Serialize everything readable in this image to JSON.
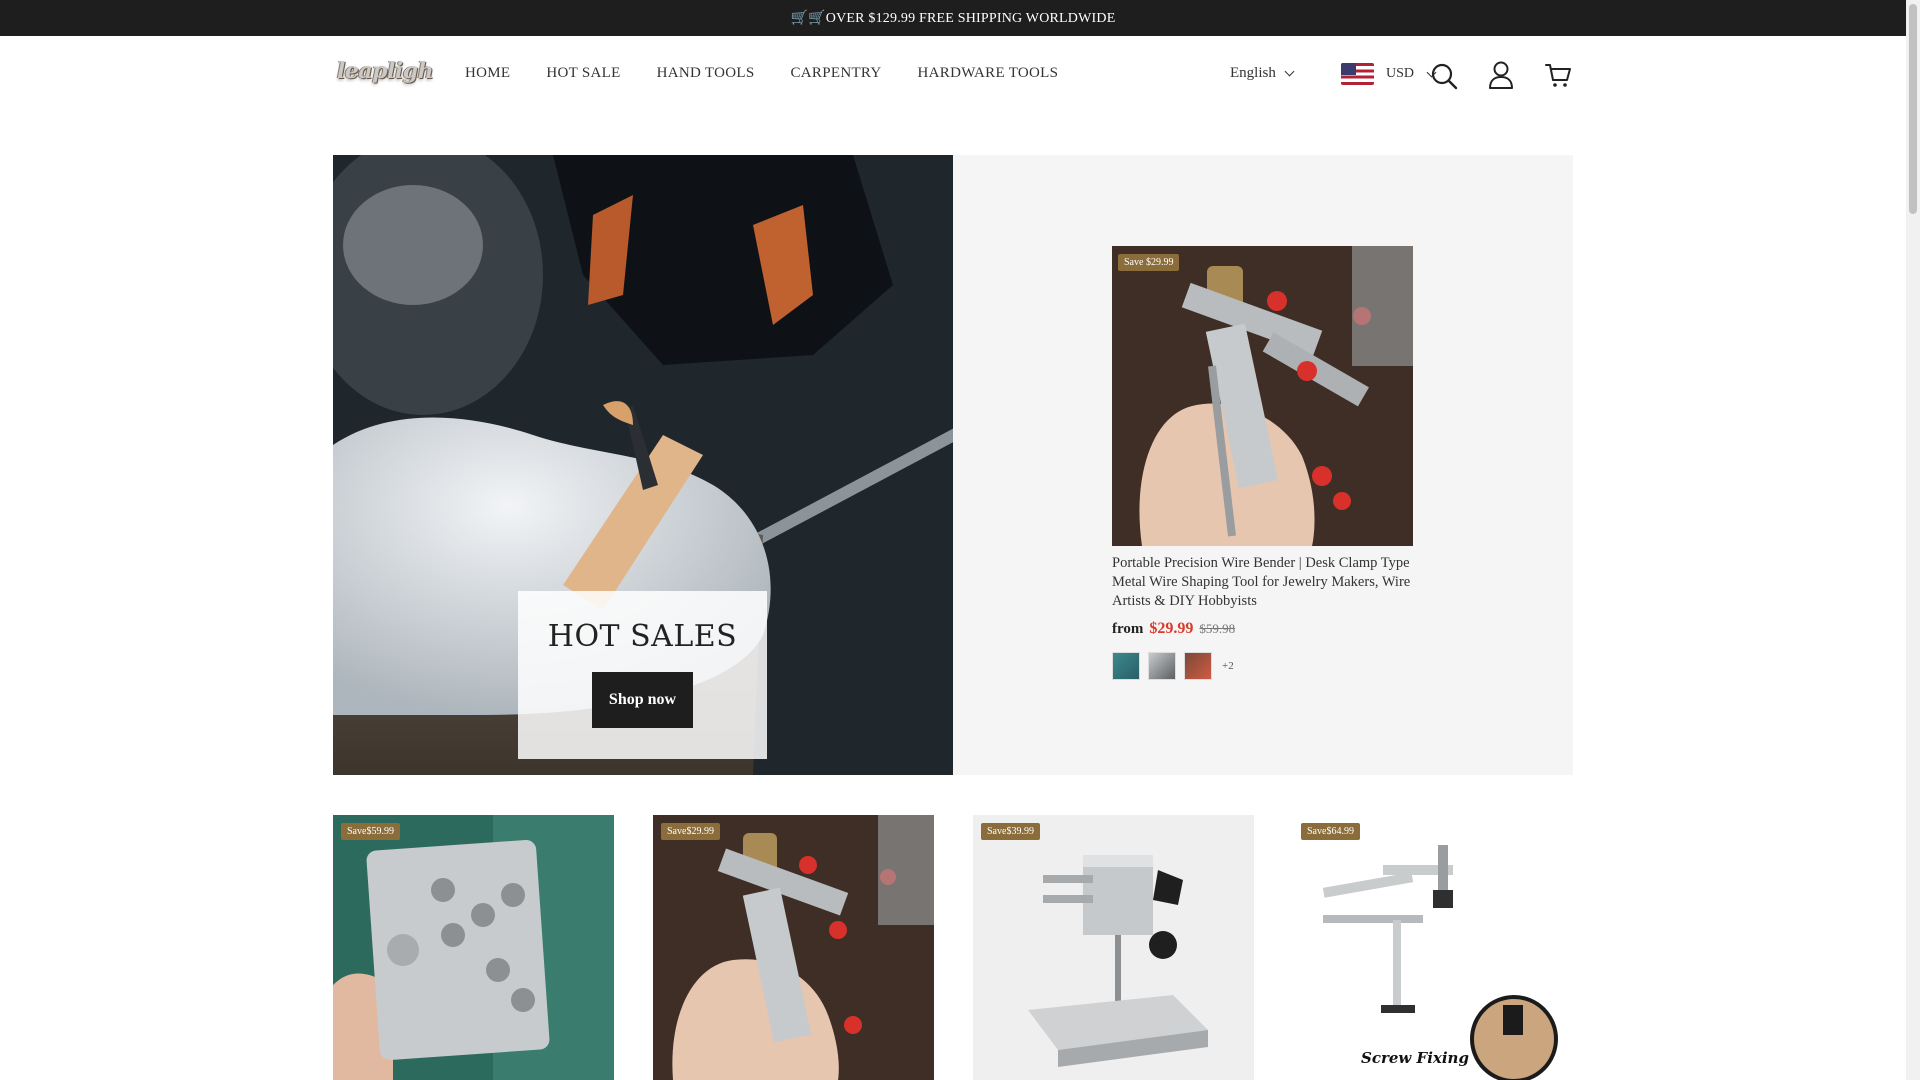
{
  "announcement": {
    "text": "🛒🛒OVER $129.99 FREE SHIPPING WORLDWIDE"
  },
  "header": {
    "logo_text": "leapligh",
    "nav": [
      "HOME",
      "HOT SALE",
      "HAND TOOLS",
      "CARPENTRY",
      "HARDWARE TOOLS"
    ],
    "language": "English",
    "currency": "USD",
    "icons": [
      "search-icon",
      "account-icon",
      "cart-icon"
    ]
  },
  "hero": {
    "title": "HOT SALES",
    "button": "Shop now"
  },
  "featured_product": {
    "badge": "Save $29.99",
    "title": "Portable Precision Wire Bender | Desk Clamp Type Metal Wire Shaping Tool for Jewelry Makers, Wire Artists & DIY Hobbyists",
    "price_prefix": "from",
    "price": "$29.99",
    "compare_price": "$59.98",
    "more_swatches": "+2"
  },
  "products": [
    {
      "badge": "Save$59.99"
    },
    {
      "badge": "Save$29.99"
    },
    {
      "badge": "Save$39.99"
    },
    {
      "badge": "Save$64.99",
      "overlay_text": "Screw Fixing"
    }
  ],
  "colors": {
    "announce_bg": "#1e1e1e",
    "sale_red": "#d83a2b",
    "badge": "#8a6d3b",
    "panel_bg": "#f5f5f5"
  }
}
